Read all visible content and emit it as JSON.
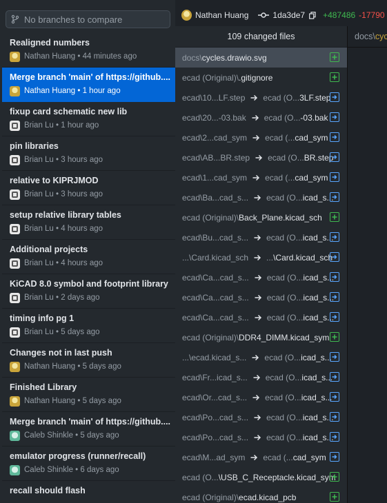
{
  "compare": {
    "placeholder": "No branches to compare",
    "icon": "branch-icon"
  },
  "commits": [
    {
      "summary": "Realigned numbers",
      "author": "Nathan Huang",
      "time": "44 minutes ago",
      "avatar": "nathan",
      "selected": false
    },
    {
      "summary": "Merge branch 'main' of https://github....",
      "author": "Nathan Huang",
      "time": "1 hour ago",
      "avatar": "nathan",
      "selected": true
    },
    {
      "summary": "fixup card schematic new lib",
      "author": "Brian Lu",
      "time": "1 hour ago",
      "avatar": "brian",
      "selected": false
    },
    {
      "summary": "pin libraries",
      "author": "Brian Lu",
      "time": "3 hours ago",
      "avatar": "brian",
      "selected": false
    },
    {
      "summary": "relative to KIPRJMOD",
      "author": "Brian Lu",
      "time": "3 hours ago",
      "avatar": "brian",
      "selected": false
    },
    {
      "summary": "setup relative library tables",
      "author": "Brian Lu",
      "time": "4 hours ago",
      "avatar": "brian",
      "selected": false
    },
    {
      "summary": "Additional projects",
      "author": "Brian Lu",
      "time": "4 hours ago",
      "avatar": "brian",
      "selected": false
    },
    {
      "summary": "KiCAD 8.0 symbol and footprint library",
      "author": "Brian Lu",
      "time": "2 days ago",
      "avatar": "brian",
      "selected": false
    },
    {
      "summary": "timing info pg 1",
      "author": "Brian Lu",
      "time": "5 days ago",
      "avatar": "brian",
      "selected": false
    },
    {
      "summary": "Changes not in last push",
      "author": "Nathan Huang",
      "time": "5 days ago",
      "avatar": "nathan",
      "selected": false
    },
    {
      "summary": "Finished Library",
      "author": "Nathan Huang",
      "time": "5 days ago",
      "avatar": "nathan",
      "selected": false
    },
    {
      "summary": "Merge branch 'main' of https://github....",
      "author": "Caleb Shinkle",
      "time": "5 days ago",
      "avatar": "caleb",
      "selected": false
    },
    {
      "summary": "emulator progress (runner/recall)",
      "author": "Caleb Shinkle",
      "time": "6 days ago",
      "avatar": "caleb",
      "selected": false
    },
    {
      "summary": "recall should flash",
      "author": "",
      "time": "",
      "avatar": "",
      "selected": false
    }
  ],
  "header": {
    "author": "Nathan Huang",
    "sha": "1da3de7",
    "additions": "+487486",
    "deletions": "-17790"
  },
  "files_panel": {
    "count_label": "109 changed files"
  },
  "files": [
    {
      "from": "",
      "from_dim": "docs\\",
      "to": "cycles.drawio.svg",
      "to_dim": "",
      "status": "added",
      "selected": true,
      "plain": true
    },
    {
      "from": "",
      "from_dim": "ecad (Original)\\",
      "to": ".gitignore",
      "to_dim": "",
      "status": "added",
      "selected": false,
      "plain": true
    },
    {
      "from": "ecad\\10...LF.step",
      "to_dim": "ecad (O...",
      "to": "3LF.step",
      "status": "renamed"
    },
    {
      "from": "ecad\\20...-03.bak",
      "to_dim": "ecad (O...",
      "to": "-03.bak",
      "status": "renamed"
    },
    {
      "from": "ecad\\2...cad_sym",
      "to_dim": "ecad (...",
      "to": "cad_sym",
      "status": "renamed"
    },
    {
      "from": "ecad\\AB...BR.step",
      "to_dim": "ecad (O...",
      "to": "BR.step",
      "status": "renamed"
    },
    {
      "from": "ecad\\1...cad_sym",
      "to_dim": "ecad (...",
      "to": "cad_sym",
      "status": "renamed"
    },
    {
      "from": "ecad\\Ba...cad_s...",
      "to_dim": "ecad (O...",
      "to": "icad_s...",
      "status": "renamed"
    },
    {
      "from": "",
      "from_dim": "ecad (Original)\\",
      "to": "Back_Plane.kicad_sch",
      "to_dim": "",
      "status": "added",
      "plain": true
    },
    {
      "from": "ecad\\Bu...cad_s...",
      "to_dim": "ecad (O...",
      "to": "icad_s...",
      "status": "renamed"
    },
    {
      "from": "...\\Card.kicad_sch",
      "to_dim": "...",
      "to": "\\Card.kicad_sch",
      "status": "renamed"
    },
    {
      "from": "ecad\\Ca...cad_s...",
      "to_dim": "ecad (O...",
      "to": "icad_s...",
      "status": "renamed"
    },
    {
      "from": "ecad\\Ca...cad_s...",
      "to_dim": "ecad (O...",
      "to": "icad_s...",
      "status": "renamed"
    },
    {
      "from": "ecad\\Ca...cad_s...",
      "to_dim": "ecad (O...",
      "to": "icad_s...",
      "status": "renamed"
    },
    {
      "from": "",
      "from_dim": "ecad (Original)\\",
      "to": "DDR4_DIMM.kicad_sym",
      "to_dim": "",
      "status": "added",
      "plain": true
    },
    {
      "from": "...\\ecad.kicad_s...",
      "to_dim": "ecad (O...",
      "to": "icad_s...",
      "status": "renamed"
    },
    {
      "from": "ecad\\Fr...icad_s...",
      "to_dim": "ecad (O...",
      "to": "icad_s...",
      "status": "renamed"
    },
    {
      "from": "ecad\\Or...cad_s...",
      "to_dim": "ecad (O...",
      "to": "icad_s...",
      "status": "renamed"
    },
    {
      "from": "ecad\\Po...cad_s...",
      "to_dim": "ecad (O...",
      "to": "icad_s...",
      "status": "renamed"
    },
    {
      "from": "ecad\\Po...cad_s...",
      "to_dim": "ecad (O...",
      "to": "icad_s...",
      "status": "renamed"
    },
    {
      "from": "ecad\\M...ad_sym",
      "to_dim": "ecad (...",
      "to": "cad_sym",
      "status": "renamed"
    },
    {
      "from": "",
      "from_dim": "ecad (O...",
      "to": "\\USB_C_Receptacle.kicad_sym",
      "to_dim": "",
      "status": "added",
      "plain": true
    },
    {
      "from": "",
      "from_dim": "ecad (Original)\\",
      "to": "ecad.kicad_pcb",
      "to_dim": "",
      "status": "added",
      "plain": true
    }
  ],
  "diff_tab": {
    "dim": "docs\\",
    "name": "cyc"
  },
  "colors": {
    "accent": "#0366d6",
    "added": "#3fb950",
    "removed": "#f85149",
    "renamed": "#58a6ff"
  }
}
